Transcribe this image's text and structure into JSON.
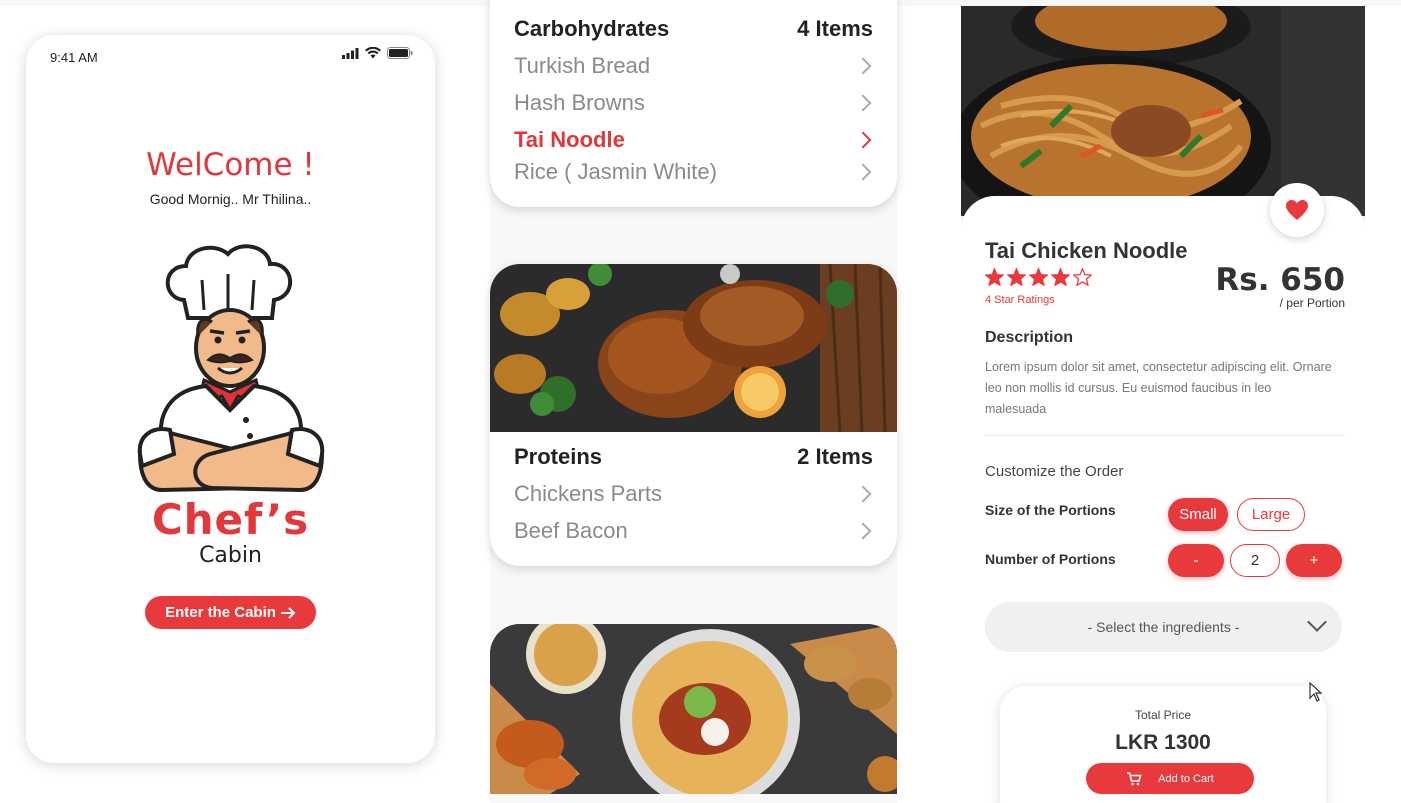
{
  "welcome_screen": {
    "time": "9:41 AM",
    "title": "WelCome !",
    "greeting": "Good Mornig.. Mr Thilina..",
    "brand_main": "Chef’s",
    "brand_sub": "Cabin",
    "enter_button": "Enter the Cabin"
  },
  "menu": {
    "categories": [
      {
        "name": "Carbohydrates",
        "count": "4 Items",
        "items": [
          {
            "label": "Turkish Bread",
            "active": false
          },
          {
            "label": "Hash Browns",
            "active": false
          },
          {
            "label": "Tai Noodle",
            "active": true
          },
          {
            "label": "Rice ( Jasmin White)",
            "active": false
          }
        ]
      },
      {
        "name": "Proteins",
        "count": "2 Items",
        "items": [
          {
            "label": "Chickens Parts",
            "active": false
          },
          {
            "label": "Beef Bacon",
            "active": false
          }
        ]
      }
    ]
  },
  "detail": {
    "dish_name": "Tai Chicken Noodle",
    "rating": 4,
    "rating_max": 5,
    "rating_text": "4 Star Ratings",
    "price": "Rs. 650",
    "price_unit": "/ per Portion",
    "description_heading": "Description",
    "description": "Lorem ipsum dolor sit amet, consectetur adipiscing elit. Ornare leo non mollis id cursus. Eu euismod faucibus in leo malesuada",
    "customize_heading": "Customize the Order",
    "size_label": "Size of the Portions",
    "size_options": [
      "Small",
      "Large"
    ],
    "size_selected": "Small",
    "portions_label": "Number of Portions",
    "decrement": "-",
    "quantity": "2",
    "increment": "+",
    "ingredients_placeholder": "- Select the ingredients -",
    "total_label": "Total Price",
    "total_value": "LKR 1300",
    "add_to_cart": "Add to Cart"
  },
  "colors": {
    "accent": "#e8393d",
    "text": "#222222",
    "muted": "#8a8a8a"
  }
}
